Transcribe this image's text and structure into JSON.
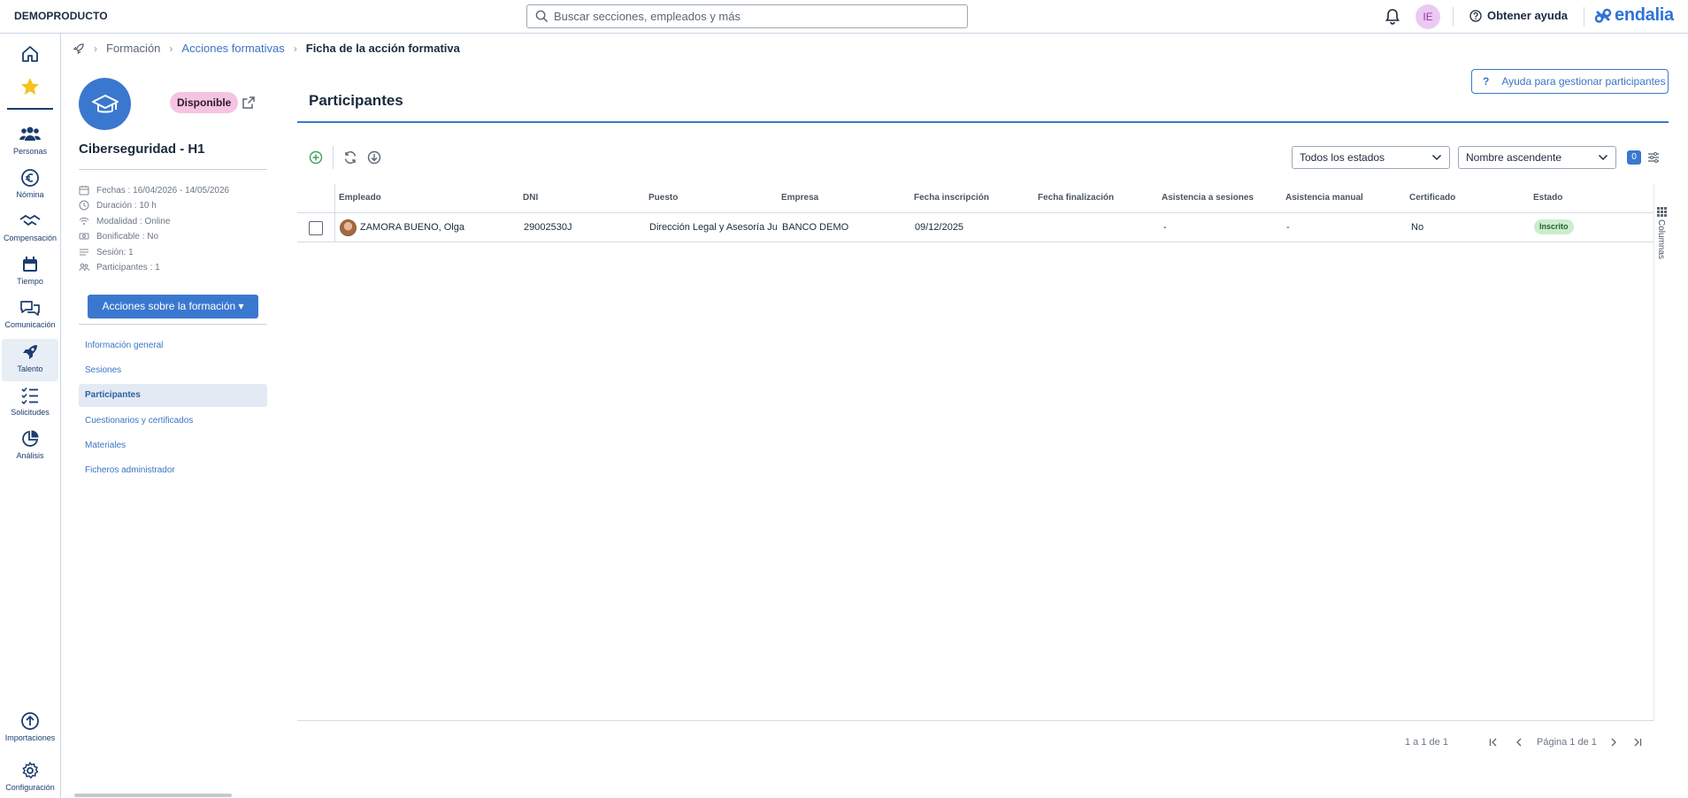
{
  "topbar": {
    "brand": "DEMOPRODUCTO",
    "search_placeholder": "Buscar secciones, empleados y más",
    "user_initials": "IE",
    "help_label": "Obtener ayuda",
    "logo_text": "endalia"
  },
  "leftnav": {
    "items": [
      {
        "label": "",
        "icon": "home-icon"
      },
      {
        "label": "",
        "icon": "star-icon"
      },
      {
        "label": "Personas",
        "icon": "people-icon"
      },
      {
        "label": "Nómina",
        "icon": "euro-icon"
      },
      {
        "label": "Compensación",
        "icon": "handshake-icon"
      },
      {
        "label": "Tiempo",
        "icon": "calendar-icon"
      },
      {
        "label": "Comunicación",
        "icon": "chat-icon"
      },
      {
        "label": "Talento",
        "icon": "rocket-icon"
      },
      {
        "label": "Solicitudes",
        "icon": "checklist-icon"
      },
      {
        "label": "Análisis",
        "icon": "pie-chart-icon"
      },
      {
        "label": "Importaciones",
        "icon": "upload-icon"
      },
      {
        "label": "Configuración",
        "icon": "gear-icon"
      }
    ],
    "active": "Talento"
  },
  "breadcrumb": {
    "items": [
      "Formación",
      "Acciones formativas",
      "Ficha de la acción formativa"
    ]
  },
  "course": {
    "status": "Disponible",
    "title": "Ciberseguridad - H1",
    "meta": [
      {
        "icon": "calendar-icon",
        "text": "Fechas : 16/04/2026 - 14/05/2026"
      },
      {
        "icon": "clock-icon",
        "text": "Duración : 10 h"
      },
      {
        "icon": "wifi-icon",
        "text": "Modalidad : Online"
      },
      {
        "icon": "money-icon",
        "text": "Bonificable : No"
      },
      {
        "icon": "list-icon",
        "text": "Sesión: 1"
      },
      {
        "icon": "group-icon",
        "text": "Participantes : 1"
      }
    ],
    "actions_button": "Acciones sobre la formación ▾",
    "menu": [
      "Información general",
      "Sesiones",
      "Participantes",
      "Cuestionarios y certificados",
      "Materiales",
      "Ficheros administrador"
    ],
    "menu_active": "Participantes"
  },
  "main": {
    "title": "Participantes",
    "help_button": "Ayuda para gestionar participantes",
    "filter_status": "Todos los estados",
    "sort": "Nombre ascendente",
    "filters_count": "0",
    "columns_label": "Columnas"
  },
  "table": {
    "columns": [
      "Empleado",
      "DNI",
      "Puesto",
      "Empresa",
      "Fecha inscripción",
      "Fecha finalización",
      "Asistencia a sesiones",
      "Asistencia manual",
      "Certificado",
      "Estado"
    ],
    "rows": [
      {
        "empleado": "ZAMORA BUENO, Olga",
        "dni": "29002530J",
        "puesto": "Dirección Legal y Asesoría Jurídica",
        "empresa": "BANCO DEMO",
        "fecha_inscripcion": "09/12/2025",
        "fecha_finalizacion": "",
        "asistencia_sesiones": "-",
        "asistencia_manual": "-",
        "certificado": "No",
        "estado": "Inscrito"
      }
    ]
  },
  "pagination": {
    "range": "1 a 1 de 1",
    "page": "Página 1 de 1"
  },
  "colors": {
    "accent": "#3a78cf",
    "badge_available": "#f5c4e3",
    "status_enrolled": "#cdeccd"
  }
}
